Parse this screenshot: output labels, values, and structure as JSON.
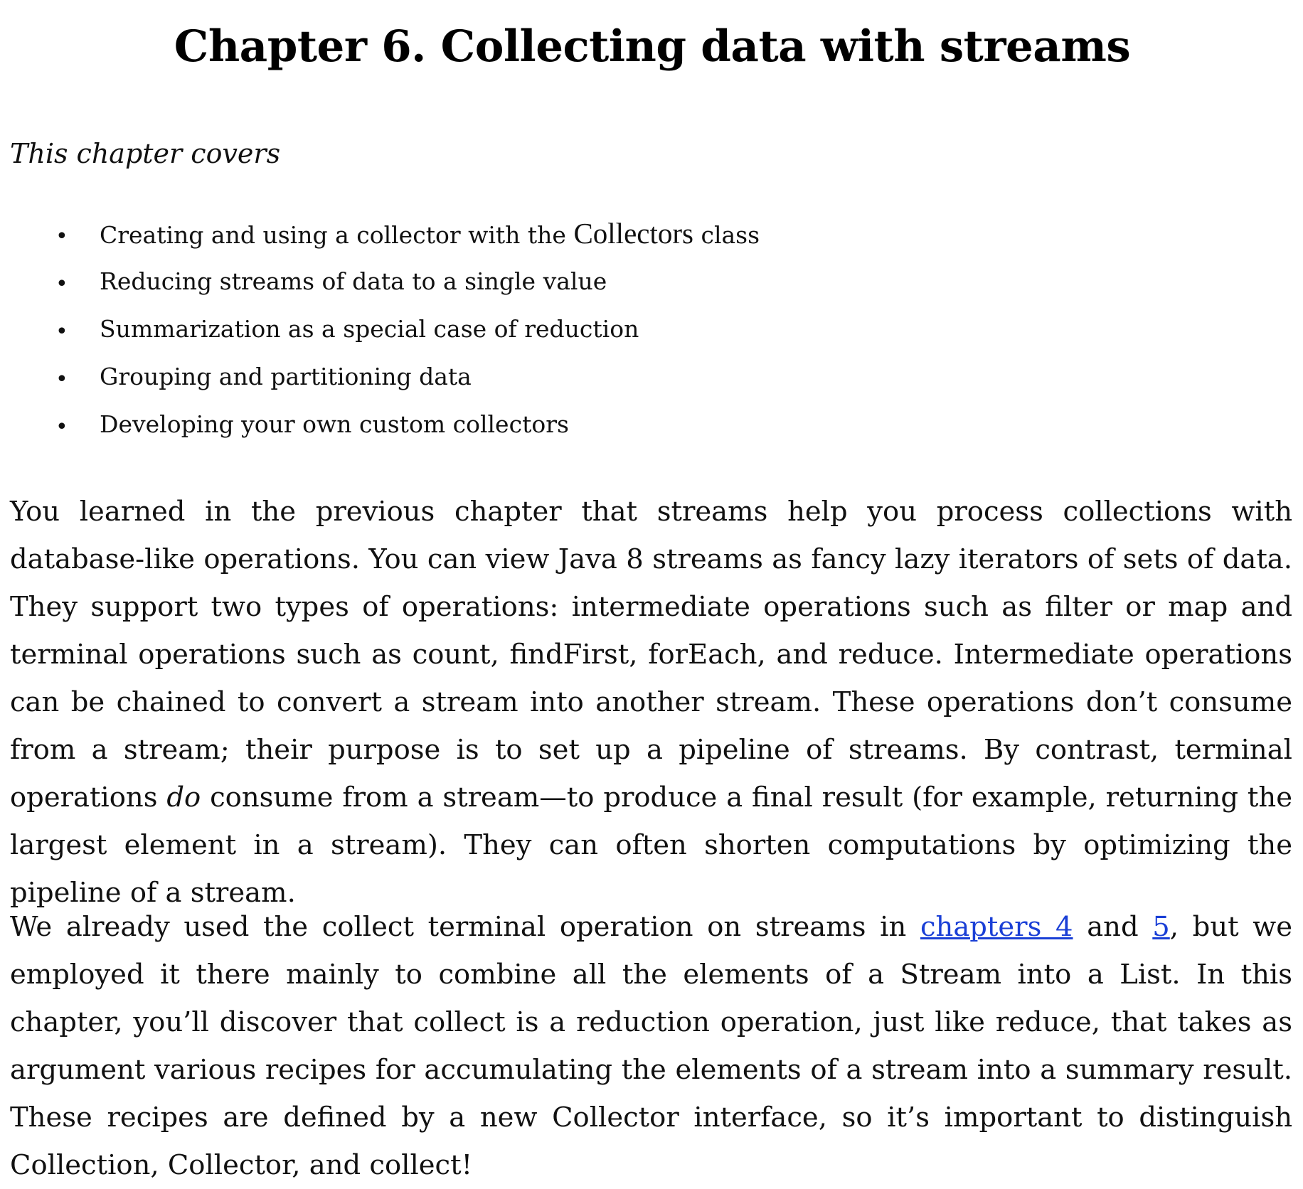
{
  "chapter": {
    "title": "Chapter 6. Collecting data with streams"
  },
  "covers": {
    "heading": "This chapter covers",
    "items": [
      {
        "before": "Creating and using a collector with the ",
        "code": "Collectors",
        "after": " class"
      },
      {
        "text": "Reducing streams of data to a single value"
      },
      {
        "text": "Summarization as a special case of reduction"
      },
      {
        "text": "Grouping and partitioning data"
      },
      {
        "text": "Developing your own custom collectors"
      }
    ]
  },
  "paragraphs": {
    "p1": {
      "before_italic": "You learned in the previous chapter that streams help you process collections with database-like operations. You can view Java 8 streams as fancy lazy iterators of sets of data. They support two types of operations: intermediate operations such as filter or map and terminal operations such as count, findFirst, forEach, and reduce. Intermediate operations can be chained to convert a stream into another stream. These operations don’t consume from a stream; their purpose is to set up a pipeline of streams. By contrast, terminal operations ",
      "italic": "do",
      "after_italic": " consume from a stream—to produce a final result (for example, returning the largest element in a stream). They can often shorten computations by optimizing the pipeline of a stream."
    },
    "p2": {
      "before_link1": "We already used the collect terminal operation on streams in ",
      "link1": "chapters 4",
      "between_links": " and ",
      "link2": "5",
      "after_link2": ", but we employed it there mainly to combine all the elements of a Stream into a List. In this chapter, you’ll discover that collect is a reduction operation, just like reduce, that takes as argument various recipes for accumulating the elements of a stream into a summary result. These recipes are defined by a new Collector interface, so it’s important to distinguish Collection, Collector, and collect!"
    }
  },
  "colors": {
    "link": "#1a3fd6",
    "text": "#111111",
    "background": "#ffffff"
  }
}
